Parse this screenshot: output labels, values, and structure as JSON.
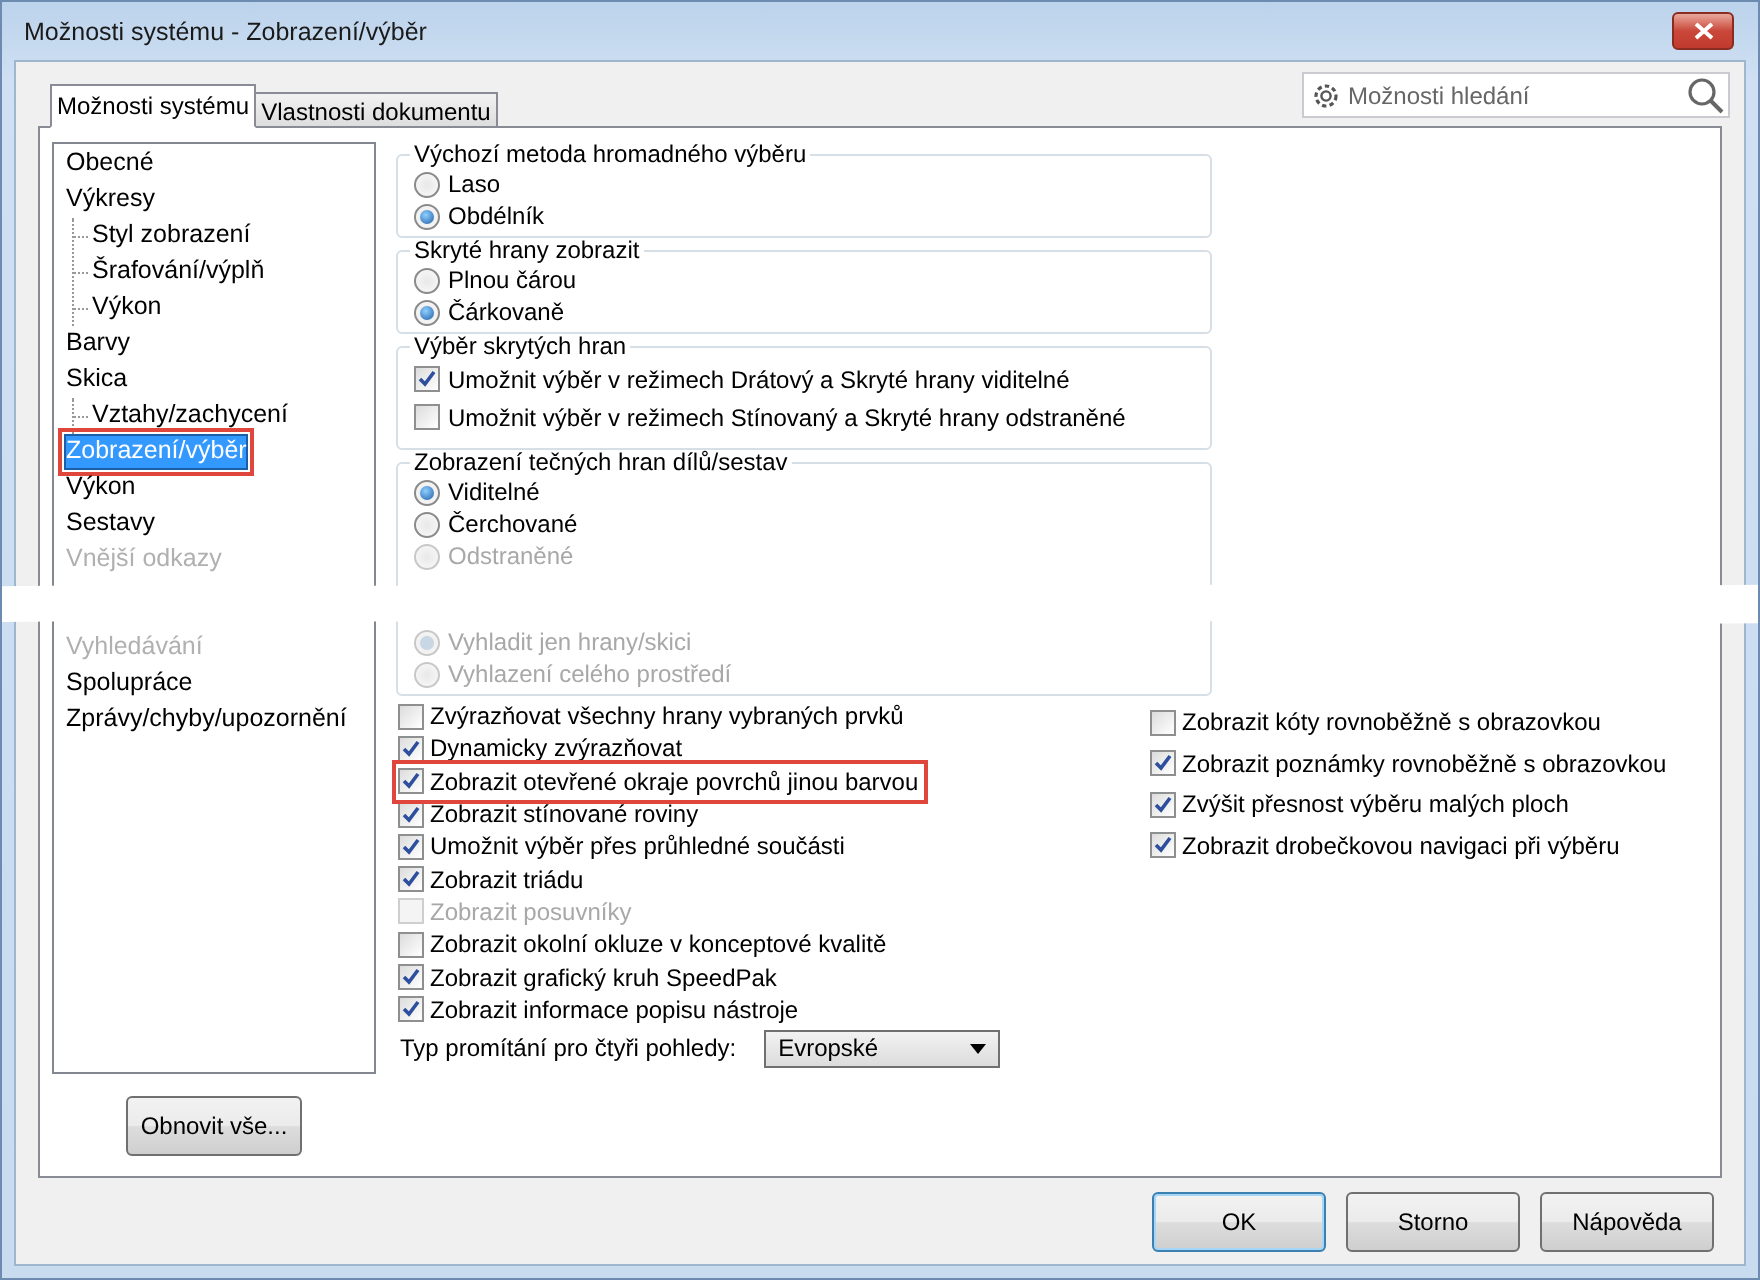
{
  "window": {
    "title": "Možnosti systému - Zobrazení/výběr"
  },
  "tabs": [
    {
      "label": "Možnosti systému",
      "selected": true
    },
    {
      "label": "Vlastnosti dokumentu",
      "selected": false
    }
  ],
  "search": {
    "placeholder": "Možnosti hledání"
  },
  "tree": [
    {
      "label": "Obecné",
      "selected": false,
      "disabled": false,
      "highlighted": false
    },
    {
      "label": "Výkresy",
      "selected": false,
      "disabled": false,
      "highlighted": false,
      "children": [
        {
          "label": "Styl zobrazení",
          "selected": false,
          "disabled": false,
          "highlighted": false
        },
        {
          "label": "Šrafování/výplň",
          "selected": false,
          "disabled": false,
          "highlighted": false
        },
        {
          "label": "Výkon",
          "selected": false,
          "disabled": false,
          "highlighted": false
        }
      ]
    },
    {
      "label": "Barvy",
      "selected": false,
      "disabled": false,
      "highlighted": false
    },
    {
      "label": "Skica",
      "selected": false,
      "disabled": false,
      "highlighted": false,
      "children": [
        {
          "label": "Vztahy/zachycení",
          "selected": false,
          "disabled": false,
          "highlighted": false
        }
      ]
    },
    {
      "label": "Zobrazení/výběr",
      "selected": true,
      "disabled": false,
      "highlighted": true
    },
    {
      "label": "Výkon",
      "selected": false,
      "disabled": false,
      "highlighted": false
    },
    {
      "label": "Sestavy",
      "selected": false,
      "disabled": false,
      "highlighted": false
    },
    {
      "label": "Vnější odkazy",
      "selected": false,
      "disabled": true,
      "highlighted": false
    },
    {
      "label": "Vyhledávání",
      "selected": false,
      "disabled": true,
      "highlighted": false
    },
    {
      "label": "Spolupráce",
      "selected": false,
      "disabled": false,
      "highlighted": false
    },
    {
      "label": "Zprávy/chyby/upozornění",
      "selected": false,
      "disabled": false,
      "highlighted": false
    }
  ],
  "groups": [
    {
      "title": "Výchozí metoda hromadného výběru",
      "kind": "radio",
      "options": [
        {
          "label": "Laso",
          "selected": false,
          "disabled": false
        },
        {
          "label": "Obdélník",
          "selected": true,
          "disabled": false
        }
      ]
    },
    {
      "title": "Skryté hrany zobrazit",
      "kind": "radio",
      "options": [
        {
          "label": "Plnou čárou",
          "selected": false,
          "disabled": false
        },
        {
          "label": "Čárkovaně",
          "selected": true,
          "disabled": false
        }
      ]
    },
    {
      "title": "Výběr skrytých hran",
      "kind": "checkbox",
      "options": [
        {
          "label": "Umožnit výběr v režimech Drátový a Skryté hrany viditelné",
          "checked": true,
          "disabled": false
        },
        {
          "label": "Umožnit výběr v režimech Stínovaný a Skryté hrany odstraněné",
          "checked": false,
          "disabled": false
        }
      ]
    },
    {
      "title": "Zobrazení tečných hran dílů/sestav",
      "kind": "radio",
      "options": [
        {
          "label": "Viditelné",
          "selected": true,
          "disabled": false
        },
        {
          "label": "Čerchované",
          "selected": false,
          "disabled": false
        },
        {
          "label": "Odstraněné",
          "selected": false,
          "disabled": true
        },
        {
          "label": "Vyhladit jen hrany/skici",
          "selected": true,
          "disabled": true
        },
        {
          "label": "Vyhlazení celého prostředí",
          "selected": false,
          "disabled": true
        }
      ]
    }
  ],
  "checks_left": [
    {
      "label": "Zvýrazňovat všechny hrany vybraných prvků",
      "checked": false,
      "disabled": false,
      "highlighted": false
    },
    {
      "label": "Dynamicky zvýrazňovat",
      "checked": true,
      "disabled": false,
      "highlighted": false
    },
    {
      "label": "Zobrazit otevřené okraje povrchů jinou barvou",
      "checked": true,
      "disabled": false,
      "highlighted": true
    },
    {
      "label": "Zobrazit stínované roviny",
      "checked": true,
      "disabled": false,
      "highlighted": false
    },
    {
      "label": "Umožnit výběr přes průhledné součásti",
      "checked": true,
      "disabled": false,
      "highlighted": false
    },
    {
      "label": "Zobrazit triádu",
      "checked": true,
      "disabled": false,
      "highlighted": false
    },
    {
      "label": "Zobrazit posuvníky",
      "checked": false,
      "disabled": true,
      "highlighted": false
    },
    {
      "label": "Zobrazit okolní okluze v konceptové kvalitě",
      "checked": false,
      "disabled": false,
      "highlighted": false
    },
    {
      "label": "Zobrazit grafický kruh SpeedPak",
      "checked": true,
      "disabled": false,
      "highlighted": false
    },
    {
      "label": "Zobrazit informace popisu nástroje",
      "checked": true,
      "disabled": false,
      "highlighted": false
    }
  ],
  "checks_right": [
    {
      "label": "Zobrazit kóty rovnoběžně s obrazovkou",
      "checked": false,
      "disabled": false,
      "highlighted": false
    },
    {
      "label": "Zobrazit poznámky rovnoběžně s obrazovkou",
      "checked": true,
      "disabled": false,
      "highlighted": false
    },
    {
      "label": "Zvýšit přesnost výběru malých ploch",
      "checked": true,
      "disabled": false,
      "highlighted": false
    },
    {
      "label": "Zobrazit drobečkovou navigaci při výběru",
      "checked": true,
      "disabled": false,
      "highlighted": false
    }
  ],
  "projection": {
    "label": "Typ promítání pro čtyři pohledy:",
    "value": "Evropské"
  },
  "reset_button": "Obnovit vše...",
  "buttons": [
    {
      "label": "OK",
      "default": true
    },
    {
      "label": "Storno",
      "default": false
    },
    {
      "label": "Nápověda",
      "default": false
    }
  ]
}
